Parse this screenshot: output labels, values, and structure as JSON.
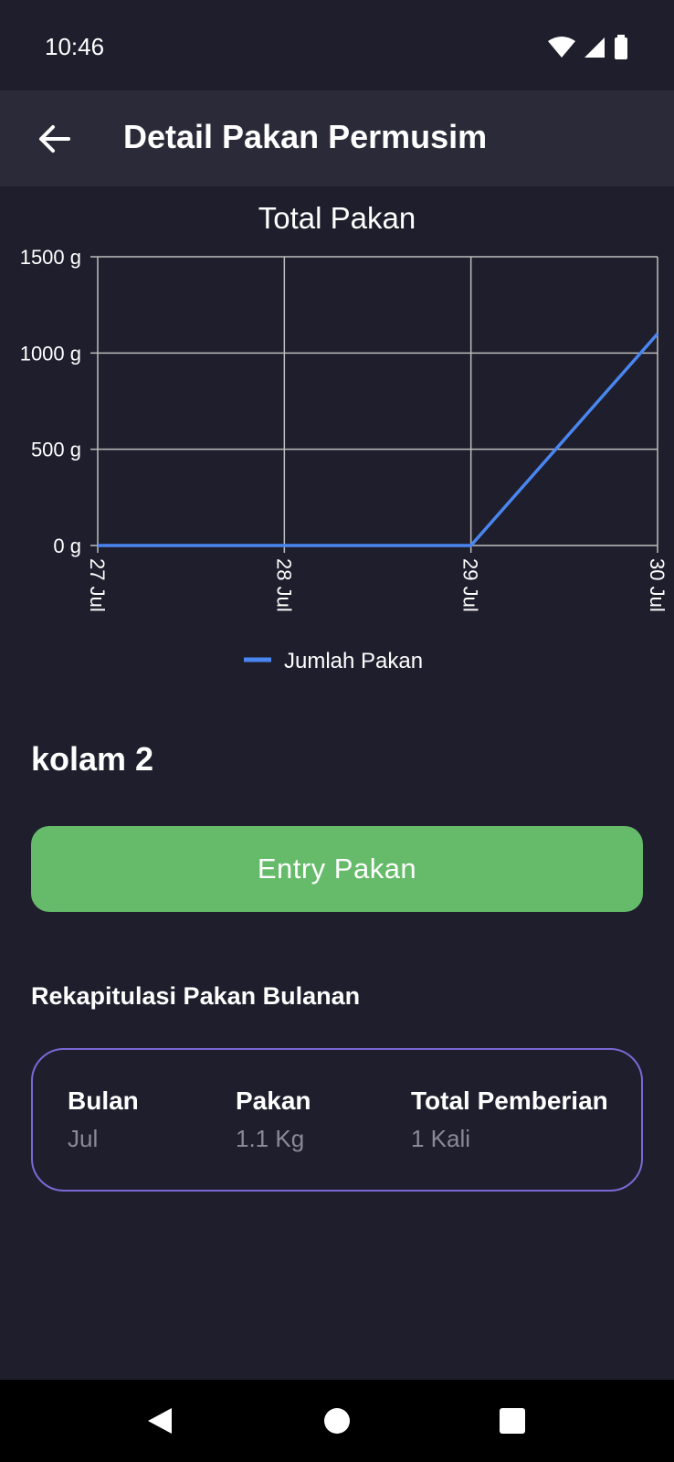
{
  "status_bar": {
    "time": "10:46",
    "icons": [
      "wifi-icon",
      "signal-icon",
      "battery-icon"
    ]
  },
  "app_bar": {
    "title": "Detail Pakan Permusim",
    "back_icon": "arrow-left-icon"
  },
  "chart_data": {
    "type": "line",
    "title": "Total Pakan",
    "categories": [
      "27 Jul",
      "28 Jul",
      "29 Jul",
      "30 Jul"
    ],
    "y_ticks": [
      "1500 g",
      "1000 g",
      "500 g",
      "0 g"
    ],
    "ylim": [
      0,
      1500
    ],
    "grid": true,
    "legend_position": "bottom",
    "series": [
      {
        "name": "Jumlah Pakan",
        "values": [
          0,
          0,
          0,
          1100
        ],
        "color": "#4a86f0"
      }
    ]
  },
  "pond": {
    "name": "kolam 2"
  },
  "entry_button": {
    "label": "Entry Pakan"
  },
  "recap": {
    "title": "Rekapitulasi Pakan Bulanan",
    "columns": [
      {
        "label": "Bulan",
        "value": "Jul"
      },
      {
        "label": "Pakan",
        "value": "1.1 Kg"
      },
      {
        "label": "Total Pemberian",
        "value": "1 Kali"
      }
    ]
  },
  "colors": {
    "background": "#1f1e2d",
    "app_bar": "#2b2a39",
    "accent_green": "#66bb6a",
    "card_border": "#7b68d4",
    "line": "#4a86f0"
  },
  "nav_bar": {
    "icons": [
      "back-triangle-icon",
      "home-circle-icon",
      "recents-square-icon"
    ]
  }
}
